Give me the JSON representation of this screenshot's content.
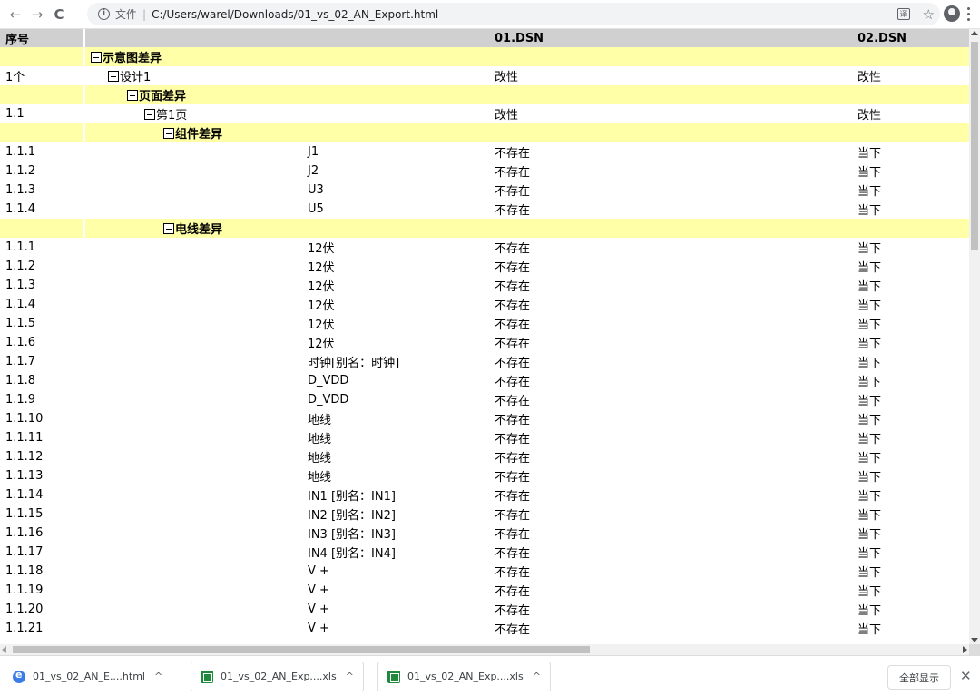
{
  "browser": {
    "back_icon": "←",
    "forward_icon": "→",
    "reload_icon": "C",
    "address": {
      "info_icon": "i",
      "scheme_label": "文件",
      "separator": "|",
      "url": "C:/Users/warel/Downloads/01_vs_02_AN_Export.html"
    },
    "translate_icon": "译",
    "star_icon": "☆"
  },
  "table": {
    "headers": {
      "seq": "序号",
      "name": "",
      "col_a": "01.DSN",
      "col_b": "02.DSN"
    },
    "schematic_section": "示意图差异",
    "design_row": {
      "seq": "1个",
      "label": "设计1",
      "a": "改性",
      "b": "改性"
    },
    "page_section": "页面差异",
    "page_row": {
      "seq": "1.1",
      "label": "第1页",
      "a": "改性",
      "b": "改性"
    },
    "component_section": "组件差异",
    "components": [
      {
        "seq": "1.1.1",
        "name": "J1",
        "a": "不存在",
        "b": "当下"
      },
      {
        "seq": "1.1.2",
        "name": "J2",
        "a": "不存在",
        "b": "当下"
      },
      {
        "seq": "1.1.3",
        "name": "U3",
        "a": "不存在",
        "b": "当下"
      },
      {
        "seq": "1.1.4",
        "name": "U5",
        "a": "不存在",
        "b": "当下"
      }
    ],
    "wire_section": "电线差异",
    "wires": [
      {
        "seq": "1.1.1",
        "name": "12伏",
        "a": "不存在",
        "b": "当下"
      },
      {
        "seq": "1.1.2",
        "name": "12伏",
        "a": "不存在",
        "b": "当下"
      },
      {
        "seq": "1.1.3",
        "name": "12伏",
        "a": "不存在",
        "b": "当下"
      },
      {
        "seq": "1.1.4",
        "name": "12伏",
        "a": "不存在",
        "b": "当下"
      },
      {
        "seq": "1.1.5",
        "name": "12伏",
        "a": "不存在",
        "b": "当下"
      },
      {
        "seq": "1.1.6",
        "name": "12伏",
        "a": "不存在",
        "b": "当下"
      },
      {
        "seq": "1.1.7",
        "name": "时钟[别名：时钟]",
        "a": "不存在",
        "b": "当下"
      },
      {
        "seq": "1.1.8",
        "name": "D_VDD",
        "a": "不存在",
        "b": "当下"
      },
      {
        "seq": "1.1.9",
        "name": "D_VDD",
        "a": "不存在",
        "b": "当下"
      },
      {
        "seq": "1.1.10",
        "name": "地线",
        "a": "不存在",
        "b": "当下"
      },
      {
        "seq": "1.1.11",
        "name": "地线",
        "a": "不存在",
        "b": "当下"
      },
      {
        "seq": "1.1.12",
        "name": "地线",
        "a": "不存在",
        "b": "当下"
      },
      {
        "seq": "1.1.13",
        "name": "地线",
        "a": "不存在",
        "b": "当下"
      },
      {
        "seq": "1.1.14",
        "name": "IN1 [别名：IN1]",
        "a": "不存在",
        "b": "当下"
      },
      {
        "seq": "1.1.15",
        "name": "IN2 [别名：IN2]",
        "a": "不存在",
        "b": "当下"
      },
      {
        "seq": "1.1.16",
        "name": "IN3 [别名：IN3]",
        "a": "不存在",
        "b": "当下"
      },
      {
        "seq": "1.1.17",
        "name": "IN4 [别名：IN4]",
        "a": "不存在",
        "b": "当下"
      },
      {
        "seq": "1.1.18",
        "name": "V +",
        "a": "不存在",
        "b": "当下"
      },
      {
        "seq": "1.1.19",
        "name": "V +",
        "a": "不存在",
        "b": "当下"
      },
      {
        "seq": "1.1.20",
        "name": "V +",
        "a": "不存在",
        "b": "当下"
      },
      {
        "seq": "1.1.21",
        "name": "V +",
        "a": "不存在",
        "b": "当下"
      }
    ]
  },
  "downloads": {
    "items": [
      {
        "label": "01_vs_02_AN_E....html",
        "chevron": "^"
      },
      {
        "label": "01_vs_02_AN_Exp....xls",
        "chevron": "^"
      },
      {
        "label": "01_vs_02_AN_Exp....xls",
        "chevron": "^"
      }
    ],
    "show_all": "全部显示",
    "close": "✕"
  },
  "colors": {
    "header_bg": "#d0d0d0",
    "section_bg": "#ffffa8",
    "status_changed": "#f0c000",
    "status_missing": "#ee2222",
    "status_current": "#22b040"
  }
}
